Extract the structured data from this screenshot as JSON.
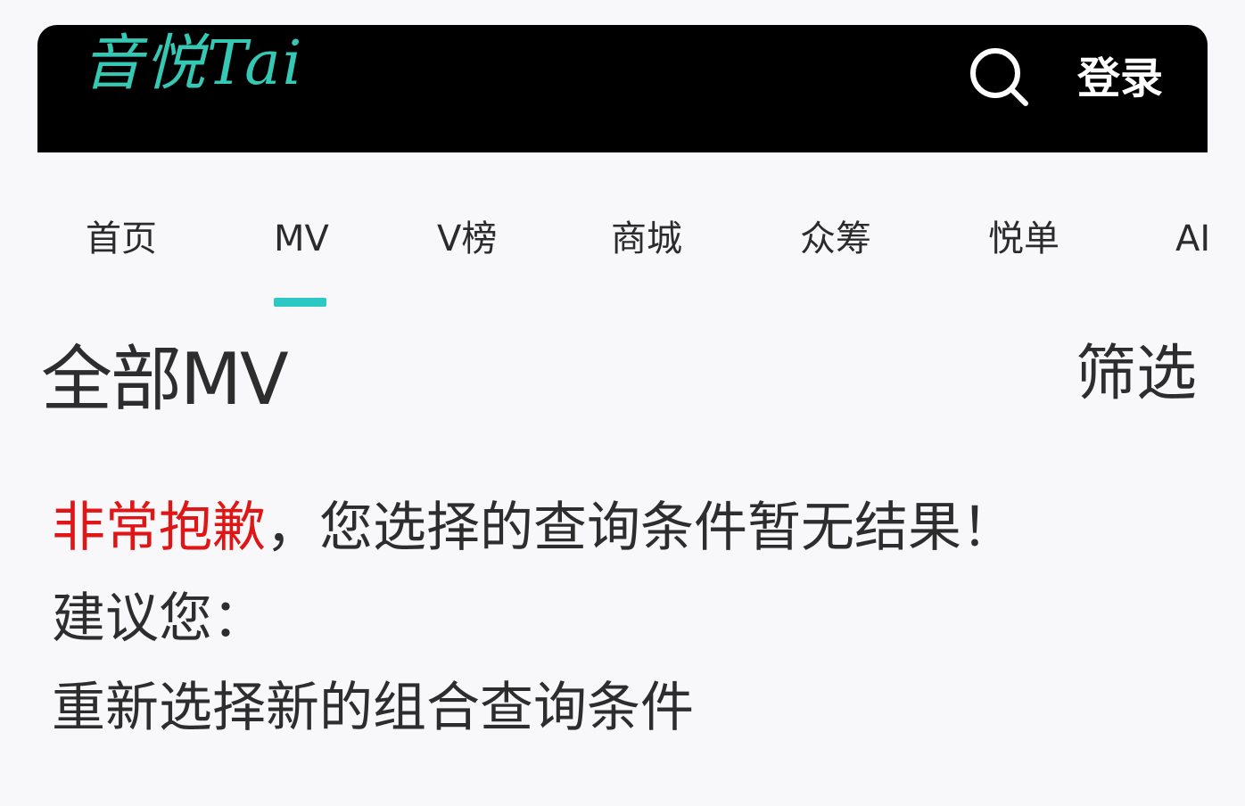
{
  "header": {
    "logo_text": "音悦Tai",
    "search_icon": "search-icon",
    "login_label": "登录",
    "colors": {
      "bar": "#000000",
      "logo": "#35c9b5",
      "login": "#ffffff"
    }
  },
  "nav": {
    "tabs": [
      {
        "label": "首页",
        "active": false
      },
      {
        "label": "MV",
        "active": true
      },
      {
        "label": "V榜",
        "active": false
      },
      {
        "label": "商城",
        "active": false
      },
      {
        "label": "众筹",
        "active": false
      },
      {
        "label": "悦单",
        "active": false
      },
      {
        "label": "AI",
        "active": false
      }
    ],
    "active_color": "#2cc9c4"
  },
  "section": {
    "title": "全部MV",
    "filter_label": "筛选"
  },
  "message": {
    "apology": "非常抱歉",
    "apology_rest": "，您选择的查询条件暂无结果！",
    "suggest": "建议您：",
    "suggestion": "重新选择新的组合查询条件",
    "apology_color": "#e01515"
  }
}
